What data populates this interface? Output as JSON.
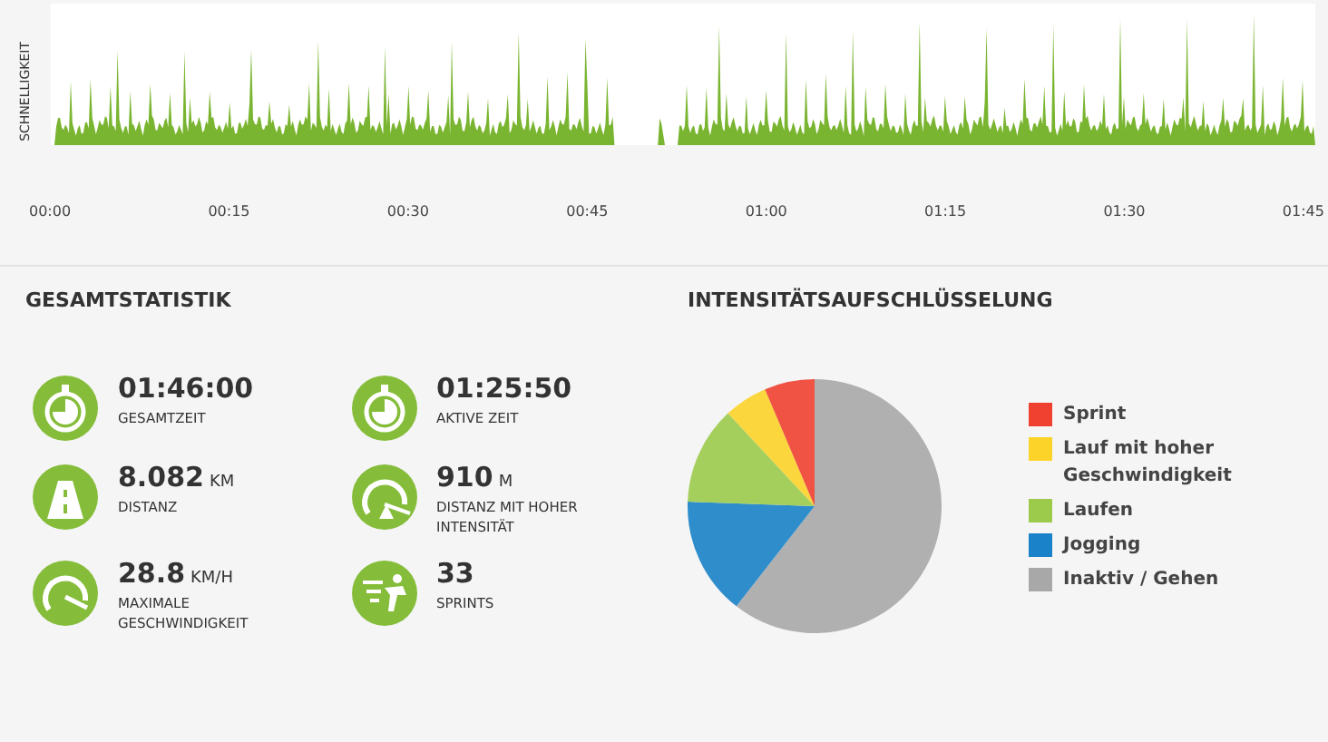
{
  "speed_chart": {
    "ylabel": "SCHNELLIGKEIT",
    "time_labels": [
      "00:00",
      "00:15",
      "00:30",
      "00:45",
      "01:00",
      "01:15",
      "01:30",
      "01:45"
    ]
  },
  "overall_stats": {
    "title": "GESAMTSTATISTIK",
    "stats": [
      {
        "kind": "stopwatch",
        "value": "01:46:00",
        "label": "GESAMTZEIT"
      },
      {
        "kind": "stopwatch",
        "value": "01:25:50",
        "label": "AKTIVE ZEIT"
      },
      {
        "kind": "road",
        "value": "8.082",
        "unit": "KM",
        "label": "DISTANZ"
      },
      {
        "kind": "gauge-road",
        "value": "910",
        "unit": "M",
        "label": "DISTANZ MIT HOHER INTENSITÄT"
      },
      {
        "kind": "gauge",
        "value": "28.8",
        "unit": "KM/H",
        "label": "MAXIMALE GESCHWINDIGKEIT"
      },
      {
        "kind": "sprinter",
        "value": "33",
        "label": "SPRINTS"
      }
    ]
  },
  "intensity": {
    "title": "INTENSITÄTSAUFSCHLÜSSELUNG",
    "legend": [
      {
        "label": "Sprint",
        "color": "#f04030"
      },
      {
        "label": "Lauf mit hoher Geschwindigkeit",
        "color": "#fcd429"
      },
      {
        "label": "Laufen",
        "color": "#9ccb4c"
      },
      {
        "label": "Jogging",
        "color": "#1a82c8"
      },
      {
        "label": "Inaktiv / Gehen",
        "color": "#a8a8a8"
      }
    ]
  }
}
